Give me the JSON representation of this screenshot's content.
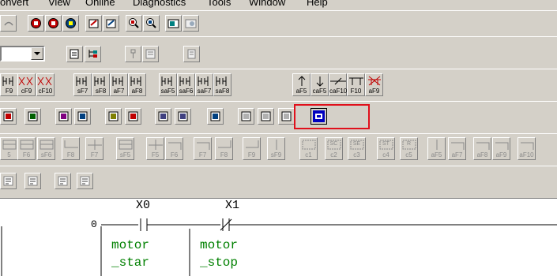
{
  "menu": [
    "onvert",
    "View",
    "Online",
    "Diagnostics",
    "Tools",
    "Window",
    "Help"
  ],
  "function_keys_row": [
    "F9",
    "cF9",
    "cF10",
    "sF7",
    "sF8",
    "aF7",
    "aF8",
    "saF5",
    "saF6",
    "saF7",
    "saF8",
    "aF5",
    "caF5",
    "caF10",
    "F10",
    "aF9"
  ],
  "function_keys_row2": [
    "5",
    "F6",
    "sF6",
    "F8",
    "F7",
    "sF5",
    "F5",
    "F6",
    "F7",
    "F8",
    "F9",
    "sF9",
    "c1",
    "c2",
    "c3",
    "c4",
    "c5",
    "aF5",
    "aF7",
    "aF8",
    "aF9",
    "aF10"
  ],
  "row2_boxed_symbols": [
    "SC",
    "SE",
    "ST",
    "R"
  ],
  "ladder": {
    "step_number": "0",
    "contacts": [
      {
        "device": "X0",
        "comment_line1": "motor",
        "comment_line2": "_star"
      },
      {
        "device": "X1",
        "comment_line1": "motor",
        "comment_line2": "_stop"
      }
    ]
  },
  "colors": {
    "highlight": "#e0101c",
    "comment_text": "#008000",
    "toolbar_bg": "#d4d0c8",
    "editor_bg": "#ffffff"
  }
}
